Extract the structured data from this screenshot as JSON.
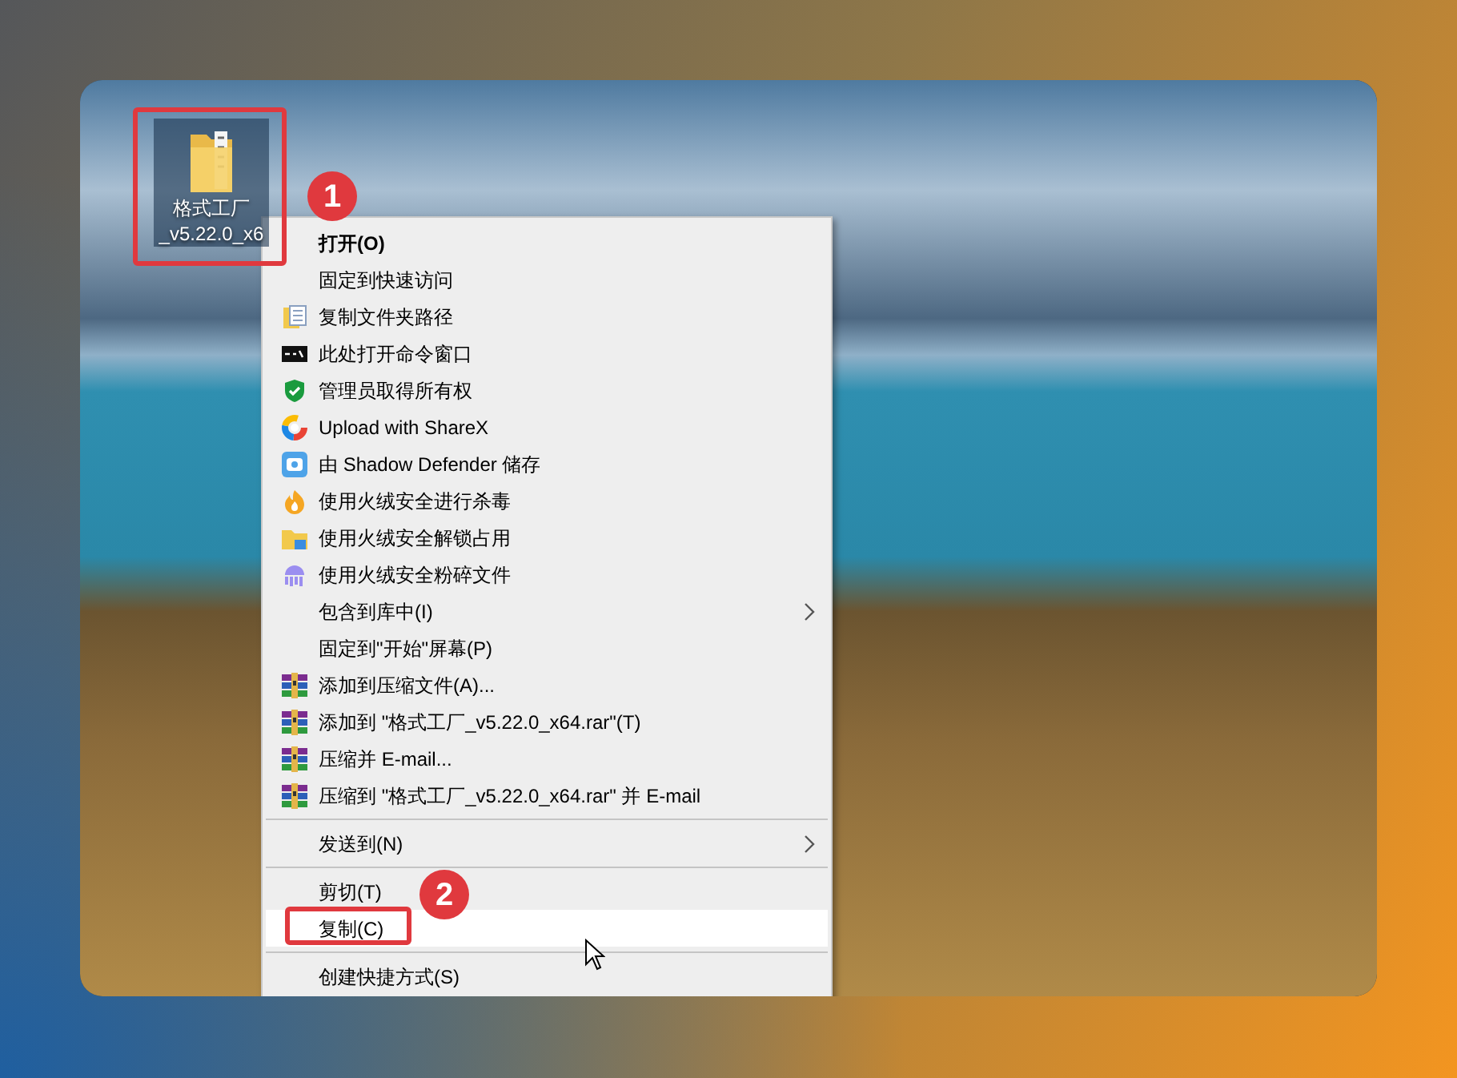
{
  "desktop_icon": {
    "label_lines": [
      "格式工厂",
      "_v5.22.0_x6"
    ],
    "selected": true
  },
  "callouts": [
    {
      "number": "1"
    },
    {
      "number": "2"
    }
  ],
  "context_menu": {
    "items": [
      {
        "kind": "plain",
        "label": "打开(O)",
        "bold": true,
        "submenu": false,
        "selected": false
      },
      {
        "kind": "plain",
        "label": "固定到快速访问",
        "bold": false,
        "submenu": false,
        "selected": false
      },
      {
        "kind": "folder-copy",
        "label": "复制文件夹路径",
        "bold": false,
        "submenu": false,
        "selected": false
      },
      {
        "kind": "terminal",
        "label": "此处打开命令窗口",
        "bold": false,
        "submenu": false,
        "selected": false
      },
      {
        "kind": "shield",
        "label": "管理员取得所有权",
        "bold": false,
        "submenu": false,
        "selected": false
      },
      {
        "kind": "sharex",
        "label": "Upload with ShareX",
        "bold": false,
        "submenu": false,
        "selected": false
      },
      {
        "kind": "defender",
        "label": "由 Shadow Defender 储存",
        "bold": false,
        "submenu": false,
        "selected": false
      },
      {
        "kind": "fire",
        "label": "使用火绒安全进行杀毒",
        "bold": false,
        "submenu": false,
        "selected": false
      },
      {
        "kind": "unlock",
        "label": "使用火绒安全解锁占用",
        "bold": false,
        "submenu": false,
        "selected": false
      },
      {
        "kind": "shred",
        "label": "使用火绒安全粉碎文件",
        "bold": false,
        "submenu": false,
        "selected": false
      },
      {
        "kind": "plain",
        "label": "包含到库中(I)",
        "bold": false,
        "submenu": true,
        "selected": false
      },
      {
        "kind": "plain",
        "label": "固定到\"开始\"屏幕(P)",
        "bold": false,
        "submenu": false,
        "selected": false
      },
      {
        "kind": "archive",
        "label": "添加到压缩文件(A)...",
        "bold": false,
        "submenu": false,
        "selected": false
      },
      {
        "kind": "archive",
        "label": "添加到 \"格式工厂_v5.22.0_x64.rar\"(T)",
        "bold": false,
        "submenu": false,
        "selected": false
      },
      {
        "kind": "archive",
        "label": "压缩并 E-mail...",
        "bold": false,
        "submenu": false,
        "selected": false
      },
      {
        "kind": "archive",
        "label": "压缩到 \"格式工厂_v5.22.0_x64.rar\" 并 E-mail",
        "bold": false,
        "submenu": false,
        "selected": false
      },
      {
        "kind": "separator"
      },
      {
        "kind": "plain",
        "label": "发送到(N)",
        "bold": false,
        "submenu": true,
        "selected": false
      },
      {
        "kind": "separator"
      },
      {
        "kind": "plain",
        "label": "剪切(T)",
        "bold": false,
        "submenu": false,
        "selected": false
      },
      {
        "kind": "plain",
        "label": "复制(C)",
        "bold": false,
        "submenu": false,
        "selected": true
      },
      {
        "kind": "separator"
      },
      {
        "kind": "plain",
        "label": "创建快捷方式(S)",
        "bold": false,
        "submenu": false,
        "selected": false
      }
    ]
  }
}
